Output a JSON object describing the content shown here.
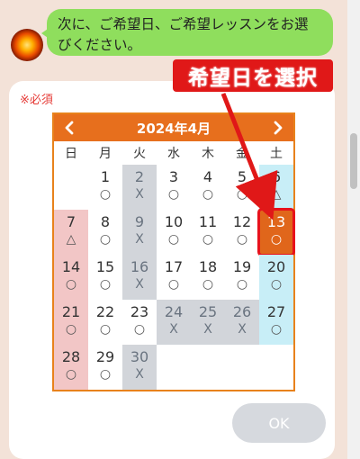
{
  "chat": {
    "message": "次に、ご希望日、ご希望レッスンをお選びください。"
  },
  "form": {
    "required_label": "※必須",
    "ok_label": "OK"
  },
  "annotation": {
    "text": "希望日を選択",
    "color": "#e01818"
  },
  "calendar": {
    "month_label": "2024年4月",
    "weekdays": [
      "日",
      "月",
      "火",
      "水",
      "木",
      "金",
      "土"
    ],
    "selected_day": 13,
    "rows": [
      [
        {
          "day": "",
          "mark": "",
          "type": "empty"
        },
        {
          "day": "1",
          "mark": "○",
          "type": "open"
        },
        {
          "day": "2",
          "mark": "X",
          "type": "closed"
        },
        {
          "day": "3",
          "mark": "○",
          "type": "open"
        },
        {
          "day": "4",
          "mark": "○",
          "type": "open"
        },
        {
          "day": "5",
          "mark": "○",
          "type": "open"
        },
        {
          "day": "6",
          "mark": "△",
          "type": "sat"
        }
      ],
      [
        {
          "day": "7",
          "mark": "△",
          "type": "sun"
        },
        {
          "day": "8",
          "mark": "○",
          "type": "open"
        },
        {
          "day": "9",
          "mark": "X",
          "type": "closed"
        },
        {
          "day": "10",
          "mark": "○",
          "type": "open"
        },
        {
          "day": "11",
          "mark": "○",
          "type": "open"
        },
        {
          "day": "12",
          "mark": "○",
          "type": "open"
        },
        {
          "day": "13",
          "mark": "○",
          "type": "selected"
        }
      ],
      [
        {
          "day": "14",
          "mark": "○",
          "type": "sun"
        },
        {
          "day": "15",
          "mark": "○",
          "type": "open"
        },
        {
          "day": "16",
          "mark": "X",
          "type": "closed"
        },
        {
          "day": "17",
          "mark": "○",
          "type": "open"
        },
        {
          "day": "18",
          "mark": "○",
          "type": "open"
        },
        {
          "day": "19",
          "mark": "○",
          "type": "open"
        },
        {
          "day": "20",
          "mark": "○",
          "type": "sat"
        }
      ],
      [
        {
          "day": "21",
          "mark": "○",
          "type": "sun"
        },
        {
          "day": "22",
          "mark": "○",
          "type": "open"
        },
        {
          "day": "23",
          "mark": "○",
          "type": "open"
        },
        {
          "day": "24",
          "mark": "X",
          "type": "closed"
        },
        {
          "day": "25",
          "mark": "X",
          "type": "closed"
        },
        {
          "day": "26",
          "mark": "X",
          "type": "closed"
        },
        {
          "day": "27",
          "mark": "○",
          "type": "sat"
        }
      ],
      [
        {
          "day": "28",
          "mark": "○",
          "type": "sun"
        },
        {
          "day": "29",
          "mark": "○",
          "type": "open"
        },
        {
          "day": "30",
          "mark": "X",
          "type": "closed"
        },
        {
          "day": "",
          "mark": "",
          "type": "empty"
        },
        {
          "day": "",
          "mark": "",
          "type": "empty"
        },
        {
          "day": "",
          "mark": "",
          "type": "empty"
        },
        {
          "day": "",
          "mark": "",
          "type": "empty"
        }
      ]
    ]
  },
  "colors": {
    "header": "#e76f1d",
    "bubble": "#8fde5d",
    "sunday": "#f2c6c6",
    "saturday": "#c8eef7",
    "closed": "#d2d5da",
    "selected": "#e0661b"
  }
}
